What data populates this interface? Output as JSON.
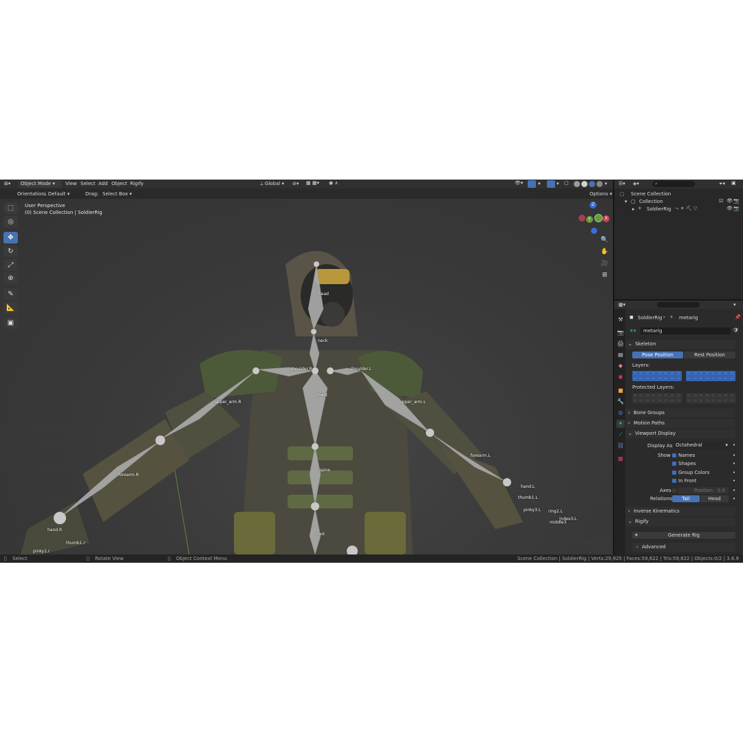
{
  "header": {
    "mode": "Object Mode",
    "menus": [
      "View",
      "Select",
      "Add",
      "Object",
      "Rigify"
    ],
    "transform_orientation": "Global",
    "options": "Options",
    "orientation_label": "Orientation:",
    "orientation_value": "Default",
    "drag_label": "Drag:",
    "drag_value": "Select Box"
  },
  "viewport": {
    "view_name": "User Perspective",
    "collection_info": "(0) Scene Collection | SoldierRig",
    "gizmo": {
      "z": "Z",
      "y": "Y",
      "x": "X"
    },
    "bones": {
      "head": "head",
      "neck": "neck",
      "shoulder_r": "shoulder.R",
      "shoulder_l": "shoulder.L",
      "chest": "chest",
      "upper_arm_r": "upper_arm.R",
      "upper_arm_l": "upper_arm.L",
      "forearm_r": "forearm.R",
      "forearm_l": "forearm.L",
      "spine": "spine",
      "hand_r": "hand.R",
      "hand_l": "hand.L",
      "thumb1_r": "thumb1.r",
      "pinky1_r": "pinky1.r",
      "root": "root",
      "thumb1_l": "thumb1.L",
      "index3_l": "index3.L",
      "middle3_l": "middle3",
      "pinky_l": "pinky3.L",
      "ring_l": "ring2.L"
    }
  },
  "outliner": {
    "root": "Scene Collection",
    "collection": "Collection",
    "object": "SoldierRig"
  },
  "properties": {
    "breadcrumb_object": "SoldierRig",
    "breadcrumb_data": "metarig",
    "data_name": "metarig",
    "skeleton": {
      "title": "Skeleton",
      "pose_position": "Pose Position",
      "rest_position": "Rest Position",
      "layers_label": "Layers:",
      "protected_label": "Protected Layers:"
    },
    "bone_groups": "Bone Groups",
    "motion_paths": "Motion Paths",
    "viewport_display": {
      "title": "Viewport Display",
      "display_as_label": "Display As",
      "display_as_value": "Octahedral",
      "show_label": "Show",
      "names": "Names",
      "shapes": "Shapes",
      "group_colors": "Group Colors",
      "in_front": "In Front",
      "axes_label": "Axes",
      "position_label": "Position",
      "position_value": "0.0",
      "relations_label": "Relations",
      "tail": "Tail",
      "head": "Head"
    },
    "inverse_kinematics": "Inverse Kinematics",
    "rigify": "Rigify",
    "generate_rig": "Generate Rig",
    "advanced": "Advanced"
  },
  "status": {
    "select": "Select",
    "rotate": "Rotate View",
    "context": "Object Context Menu",
    "stats": "Scene Collection | SoldierRig | Verts:29,925 | Faces:59,822 | Tris:59,822 | Objects:0/2 | 3.6.9"
  },
  "colors": {
    "accent": "#4772b3",
    "layer_active": "#3d6fc0",
    "bone": "#a8a8a8"
  }
}
